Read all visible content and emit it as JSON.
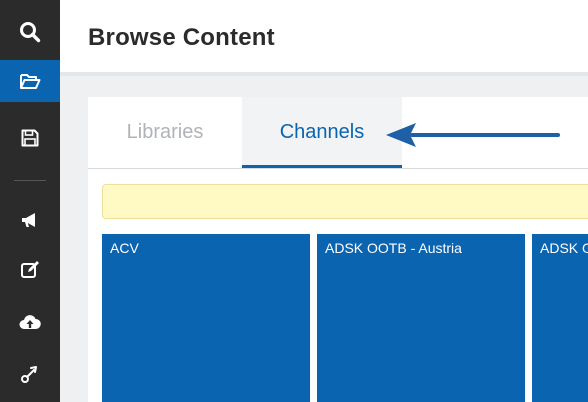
{
  "header": {
    "title": "Browse Content"
  },
  "sidebar": {
    "items": [
      {
        "icon": "search-icon",
        "active": false
      },
      {
        "icon": "folder-open-icon",
        "active": true
      },
      {
        "icon": "save-icon",
        "active": false
      },
      {
        "icon": "megaphone-icon",
        "active": false
      },
      {
        "icon": "edit-icon",
        "active": false
      },
      {
        "icon": "cloud-upload-icon",
        "active": false
      },
      {
        "icon": "link-icon",
        "active": false
      }
    ]
  },
  "tabs": [
    {
      "label": "Libraries",
      "active": false
    },
    {
      "label": "Channels",
      "active": true
    }
  ],
  "channels": [
    {
      "name": "ACV"
    },
    {
      "name": "ADSK OOTB - Austria"
    },
    {
      "name": "ADSK OOTB"
    }
  ],
  "colors": {
    "accent": "#0a64b0",
    "sidebar": "#2b2b2b",
    "banner": "#fff9c4"
  }
}
